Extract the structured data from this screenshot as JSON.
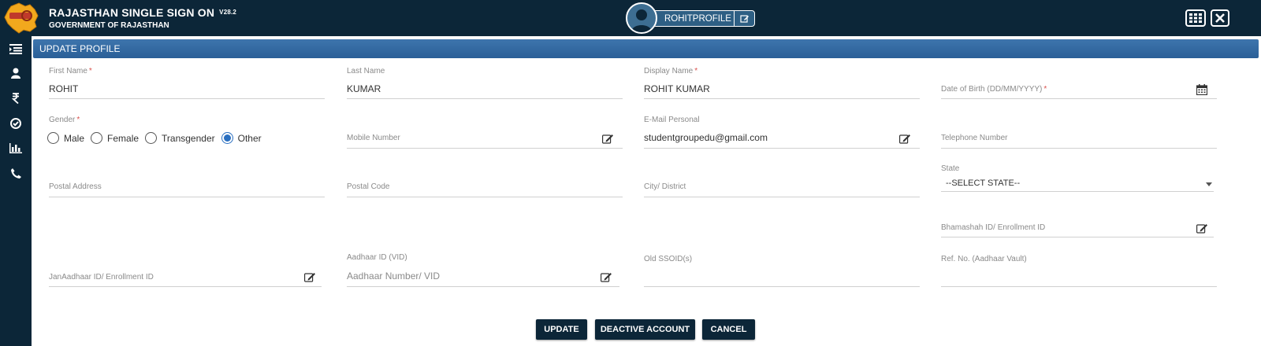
{
  "header": {
    "title": "RAJASTHAN SINGLE SIGN ON",
    "version": "V28.2",
    "subtitle": "GOVERNMENT OF RAJASTHAN",
    "profile_name": "ROHITPROFILE"
  },
  "sidebar": {
    "items": [
      {
        "icon": "menu-list-icon"
      },
      {
        "icon": "user-icon"
      },
      {
        "icon": "rupee-icon"
      },
      {
        "icon": "check-circle-icon"
      },
      {
        "icon": "bar-chart-icon"
      },
      {
        "icon": "phone-icon"
      }
    ]
  },
  "panel": {
    "title": "UPDATE PROFILE"
  },
  "form": {
    "first_name": {
      "label": "First Name",
      "required": "*",
      "value": "ROHIT"
    },
    "last_name": {
      "label": "Last Name",
      "value": "KUMAR"
    },
    "display_name": {
      "label": "Display Name",
      "required": "*",
      "value": "ROHIT KUMAR"
    },
    "dob": {
      "placeholder": "Date of Birth (DD/MM/YYYY)",
      "required": "*"
    },
    "gender": {
      "label": "Gender",
      "required": "*",
      "options": [
        "Male",
        "Female",
        "Transgender",
        "Other"
      ],
      "selected": "Other"
    },
    "mobile": {
      "placeholder": "Mobile Number"
    },
    "email": {
      "label": "E-Mail Personal",
      "value": "studentgroupedu@gmail.com"
    },
    "telephone": {
      "placeholder": "Telephone Number"
    },
    "postal_address": {
      "placeholder": "Postal Address"
    },
    "postal_code": {
      "placeholder": "Postal Code"
    },
    "city": {
      "placeholder": "City/ District"
    },
    "state": {
      "label": "State",
      "value": "--SELECT STATE--"
    },
    "bhamashah": {
      "placeholder": "Bhamashah ID/ Enrollment ID"
    },
    "janaadhaar": {
      "placeholder": "JanAadhaar ID/ Enrollment ID"
    },
    "aadhaar": {
      "label": "Aadhaar ID (VID)",
      "placeholder": "Aadhaar Number/ VID"
    },
    "old_ssoid": {
      "placeholder": "Old SSOID(s)"
    },
    "ref_no": {
      "placeholder": "Ref. No. (Aadhaar Vault)"
    }
  },
  "buttons": {
    "update": "UPDATE",
    "deactivate": "DEACTIVE ACCOUNT",
    "cancel": "CANCEL"
  },
  "colors": {
    "topbar": "#0c2638",
    "panel_header": "#3e75ad",
    "required": "#d9534f",
    "radio_selected": "#2a6fc0"
  }
}
